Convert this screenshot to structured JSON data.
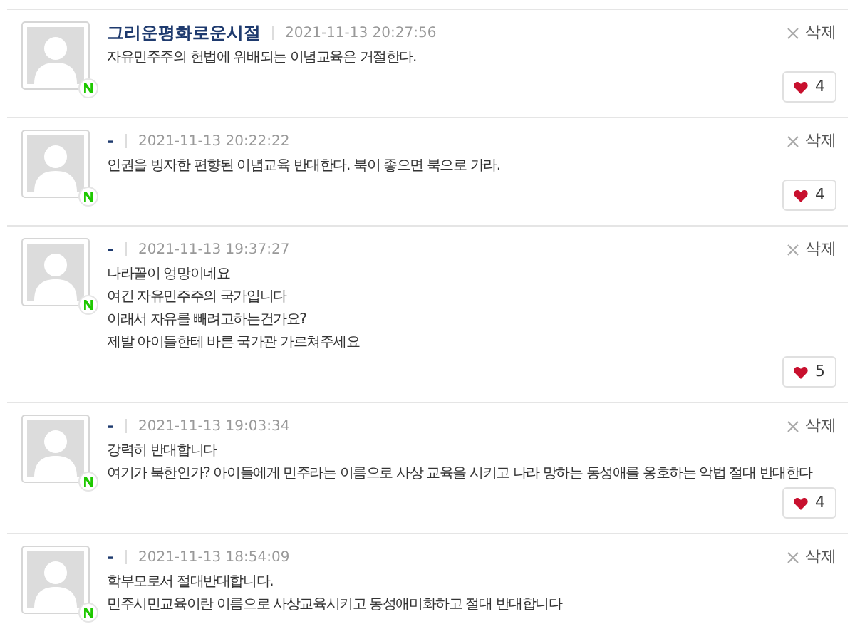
{
  "comments": [
    {
      "author": "그리운평화로운시절",
      "time": "2021-11-13 20:27:56",
      "delete": "삭제",
      "lines": [
        "자유민주주의 헌법에 위배되는 이념교육은 거절한다."
      ],
      "likes": "4"
    },
    {
      "author": "-",
      "time": "2021-11-13 20:22:22",
      "delete": "삭제",
      "lines": [
        "인권을 빙자한 편향된 이념교육 반대한다. 북이 좋으면 북으로 가라."
      ],
      "likes": "4"
    },
    {
      "author": "-",
      "time": "2021-11-13 19:37:27",
      "delete": "삭제",
      "lines": [
        "나라꼴이 엉망이네요",
        "여긴 자유민주주의 국가입니다",
        "이래서 자유를 빼려고하는건가요?",
        "제발 아이들한테 바른 국가관 가르쳐주세요"
      ],
      "likes": "5"
    },
    {
      "author": "-",
      "time": "2021-11-13 19:03:34",
      "delete": "삭제",
      "lines": [
        "강력히 반대합니다",
        "여기가 북한인가? 아이들에게 민주라는 이름으로 사상 교육을 시키고 나라 망하는 동성애를 옹호하는 악법 절대 반대한다"
      ],
      "likes": "4"
    },
    {
      "author": "-",
      "time": "2021-11-13 18:54:09",
      "delete": "삭제",
      "lines": [
        "학부모로서 절대반대합니다.",
        "민주시민교육이란 이름으로 사상교육시키고 동성애미화하고 절대 반대합니다"
      ]
    }
  ]
}
